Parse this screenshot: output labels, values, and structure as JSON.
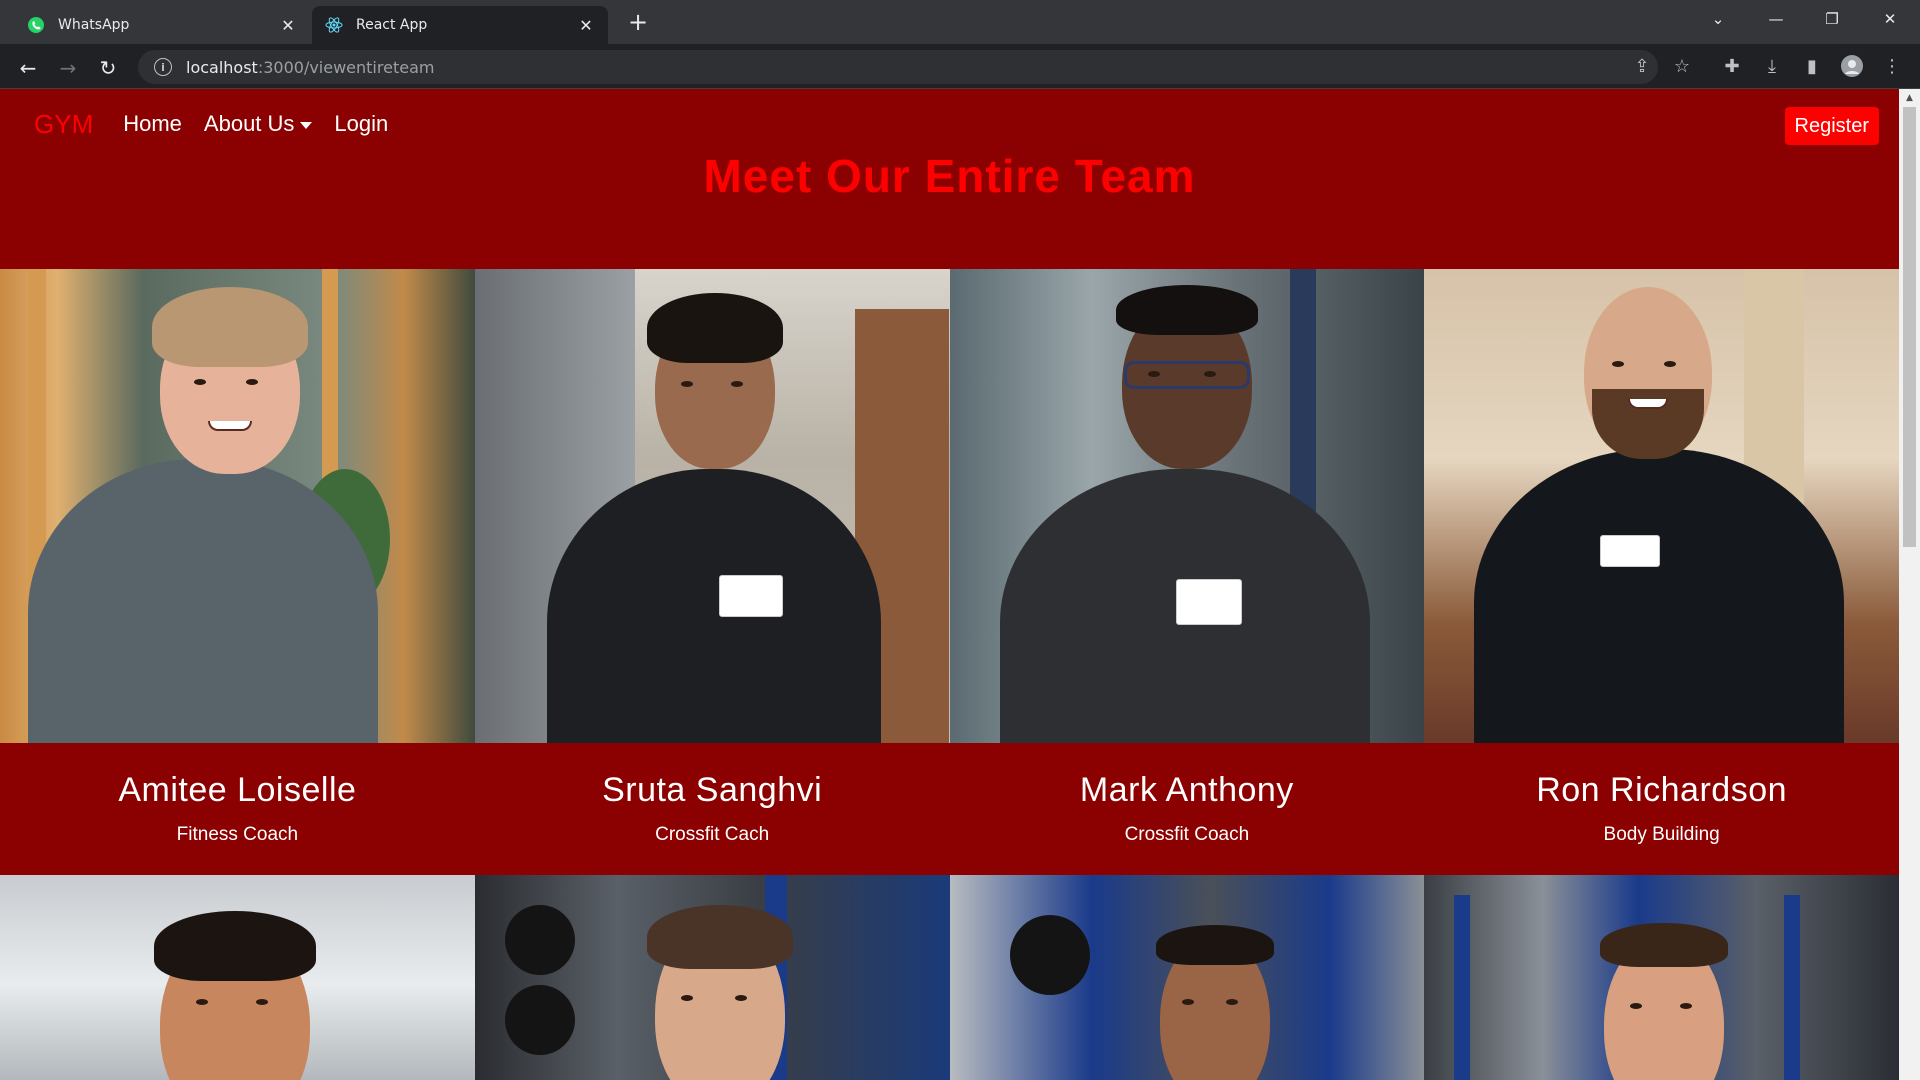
{
  "browser": {
    "tabs": [
      {
        "title": "WhatsApp",
        "favicon": "whatsapp-icon",
        "active": false
      },
      {
        "title": "React App",
        "favicon": "react-icon",
        "active": true
      }
    ],
    "url_host": "localhost",
    "url_path": ":3000/viewentireteam"
  },
  "navbar": {
    "brand": "GYM",
    "links": [
      "Home",
      "About Us",
      "Login"
    ],
    "register_label": "Register"
  },
  "page_title": "Meet Our Entire Team",
  "team": [
    {
      "name": "Amitee Loiselle",
      "role": "Fitness Coach"
    },
    {
      "name": "Sruta Sanghvi",
      "role": "Crossfit Cach"
    },
    {
      "name": "Mark Anthony",
      "role": "Crossfit Coach"
    },
    {
      "name": "Ron Richardson",
      "role": "Body Building"
    }
  ],
  "colors": {
    "page_bg": "#8b0000",
    "accent": "#ff0000",
    "text": "#ffffff"
  }
}
